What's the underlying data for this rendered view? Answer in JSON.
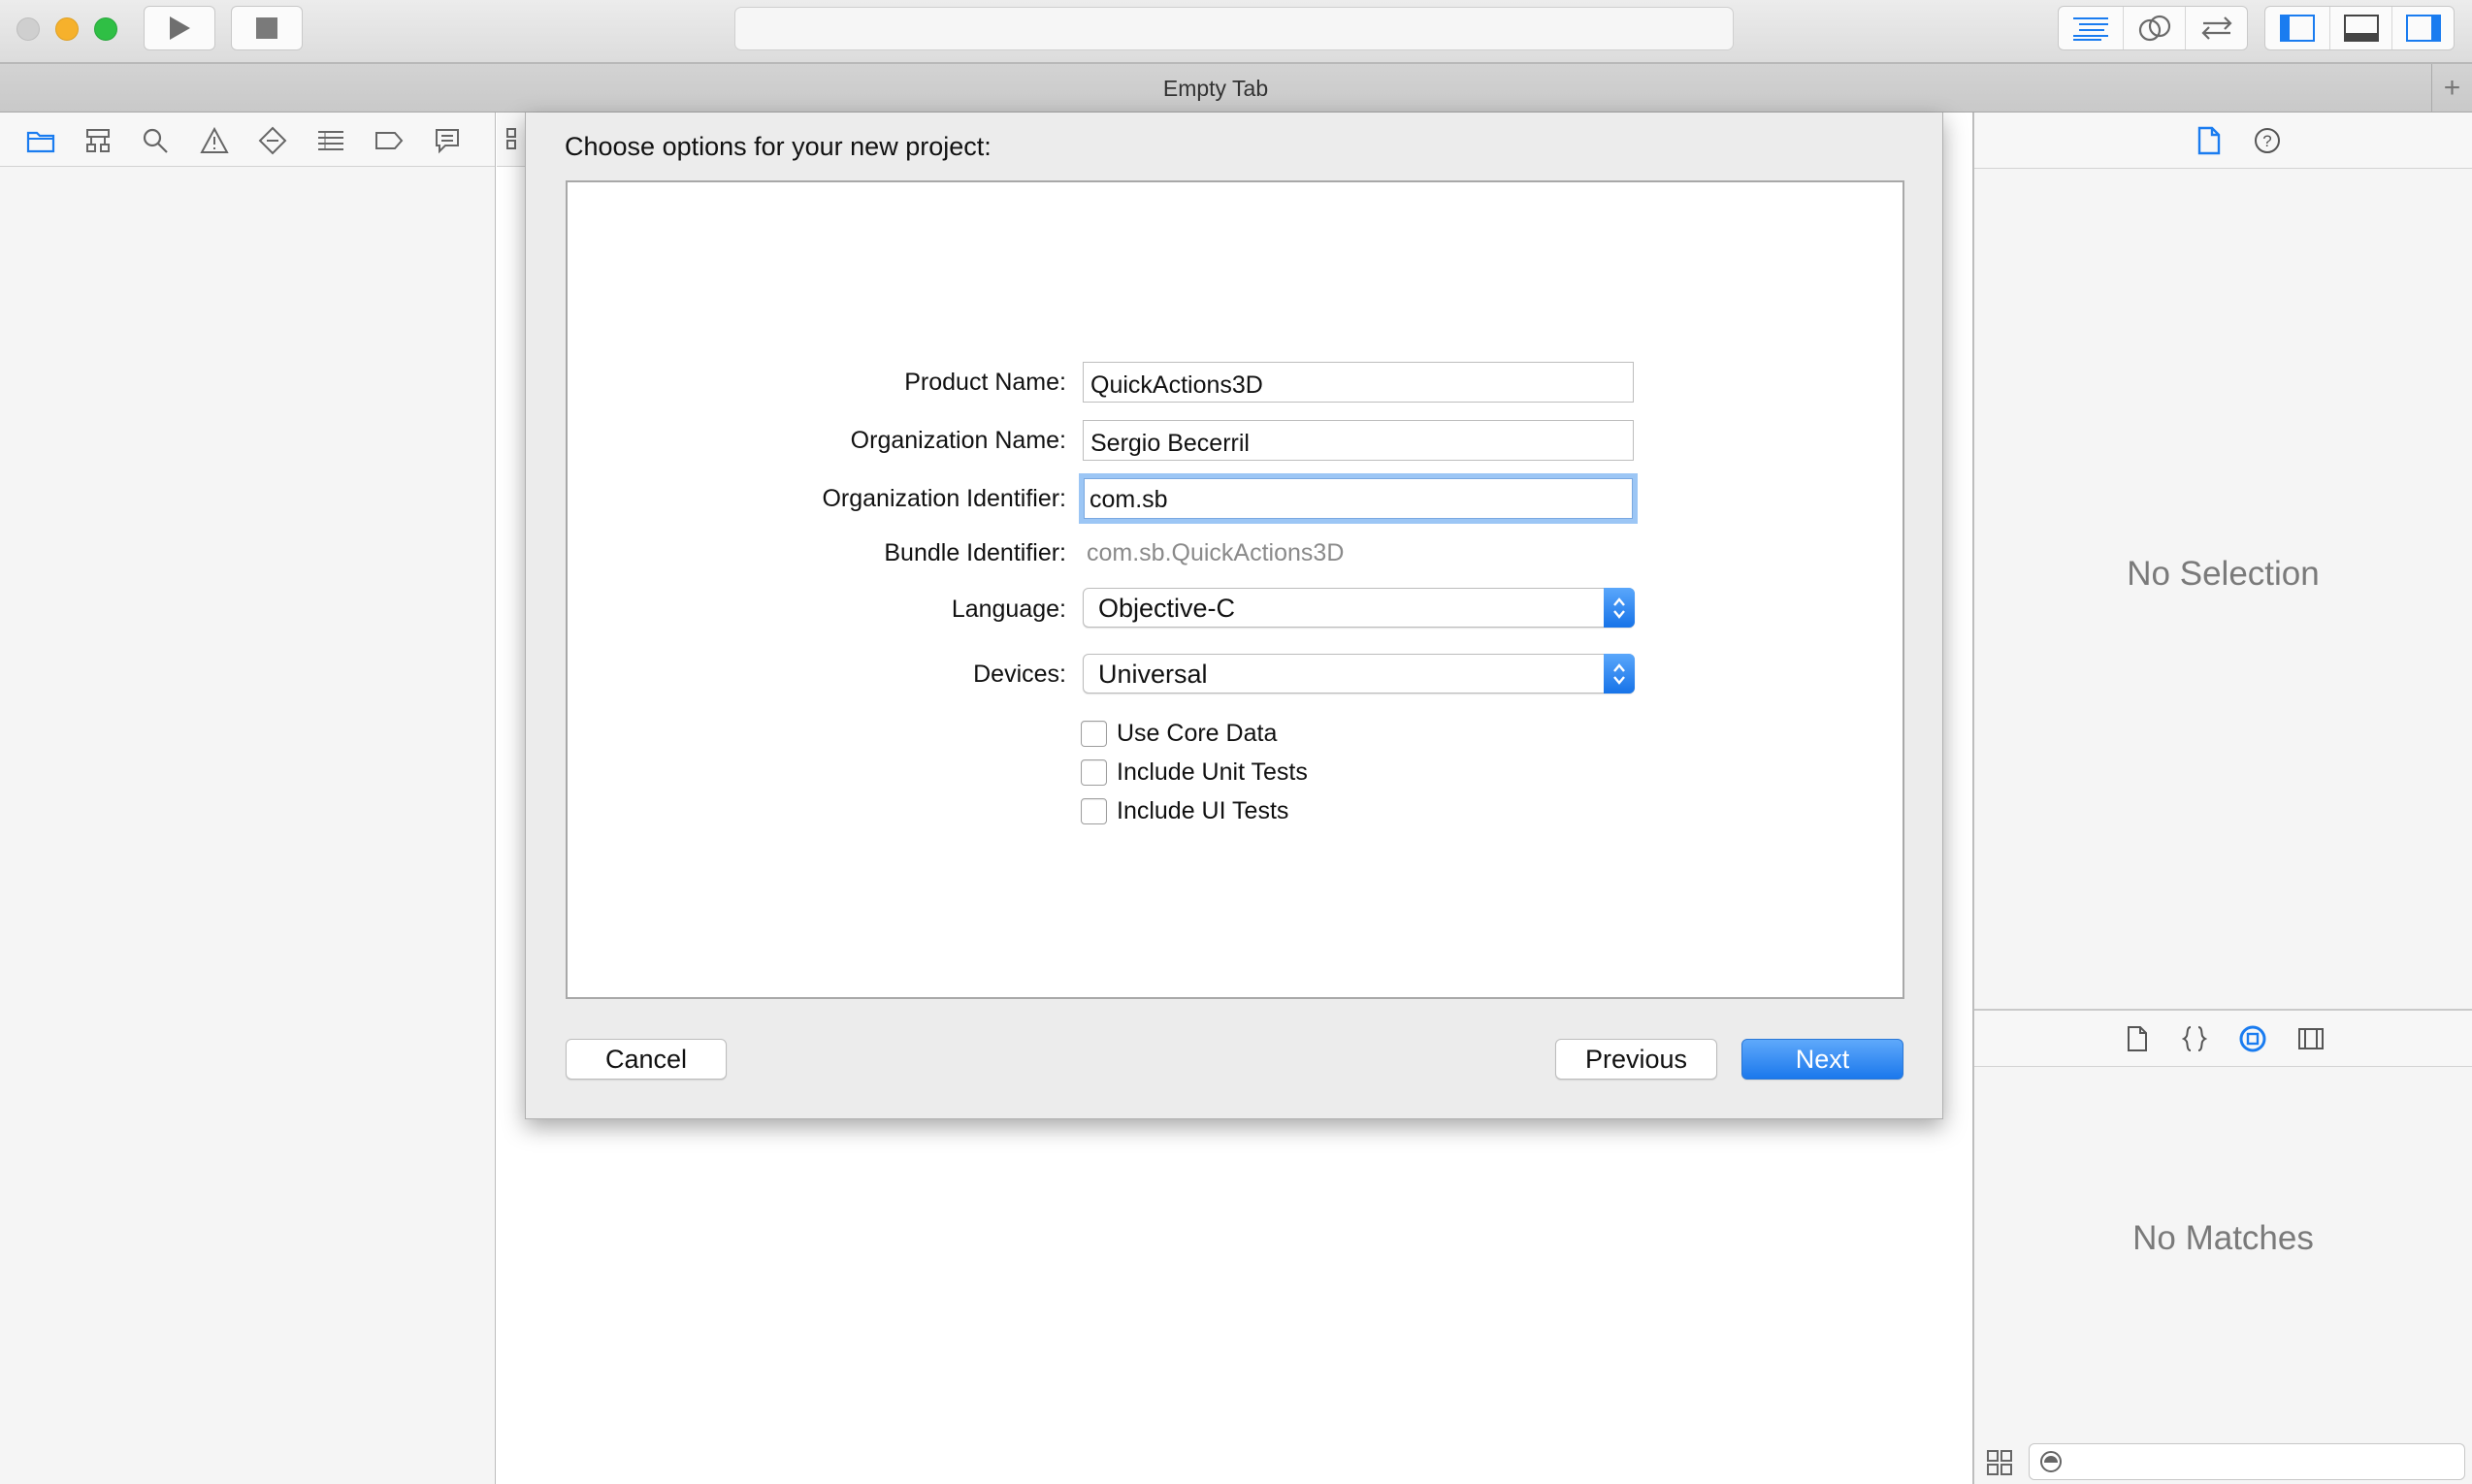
{
  "window": {
    "tab_title": "Empty Tab",
    "tab_add": "+"
  },
  "toolbar": {
    "traffic_lights": {
      "close": "#cfcfcf",
      "minimize": "#f6b12c",
      "zoom": "#2fbf45"
    },
    "run_icon": "play-icon",
    "stop_icon": "stop-icon",
    "activity_text": "",
    "editor_modes": [
      "standard-editor-icon",
      "assistant-editor-icon",
      "version-editor-icon"
    ],
    "panel_toggles": [
      "navigator-toggle-icon",
      "debug-toggle-icon",
      "utilities-toggle-icon"
    ],
    "accent": "#1a7cf0"
  },
  "navigator": {
    "icons": [
      "folder-icon",
      "hierarchy-icon",
      "search-icon",
      "warning-icon",
      "test-icon",
      "debug-icon",
      "breakpoint-icon",
      "report-icon"
    ]
  },
  "dialog": {
    "title": "Choose options for your new project:",
    "fields": {
      "product_name": {
        "label": "Product Name:",
        "value": "QuickActions3D"
      },
      "org_name": {
        "label": "Organization Name:",
        "value": "Sergio Becerril"
      },
      "org_id": {
        "label": "Organization Identifier:",
        "value": "com.sb"
      },
      "bundle_id": {
        "label": "Bundle Identifier:",
        "value": "com.sb.QuickActions3D"
      },
      "language": {
        "label": "Language:",
        "value": "Objective-C"
      },
      "devices": {
        "label": "Devices:",
        "value": "Universal"
      }
    },
    "checkboxes": [
      {
        "label": "Use Core Data",
        "checked": false
      },
      {
        "label": "Include Unit Tests",
        "checked": false
      },
      {
        "label": "Include UI Tests",
        "checked": false
      }
    ],
    "buttons": {
      "cancel": "Cancel",
      "previous": "Previous",
      "next": "Next"
    }
  },
  "utilities": {
    "inspector_icons": [
      "file-inspector-icon",
      "quick-help-icon"
    ],
    "no_selection": "No Selection",
    "library_icons": [
      "file-template-icon",
      "code-snippet-icon",
      "object-library-icon",
      "media-library-icon"
    ],
    "no_matches": "No Matches",
    "filter_placeholder": ""
  }
}
